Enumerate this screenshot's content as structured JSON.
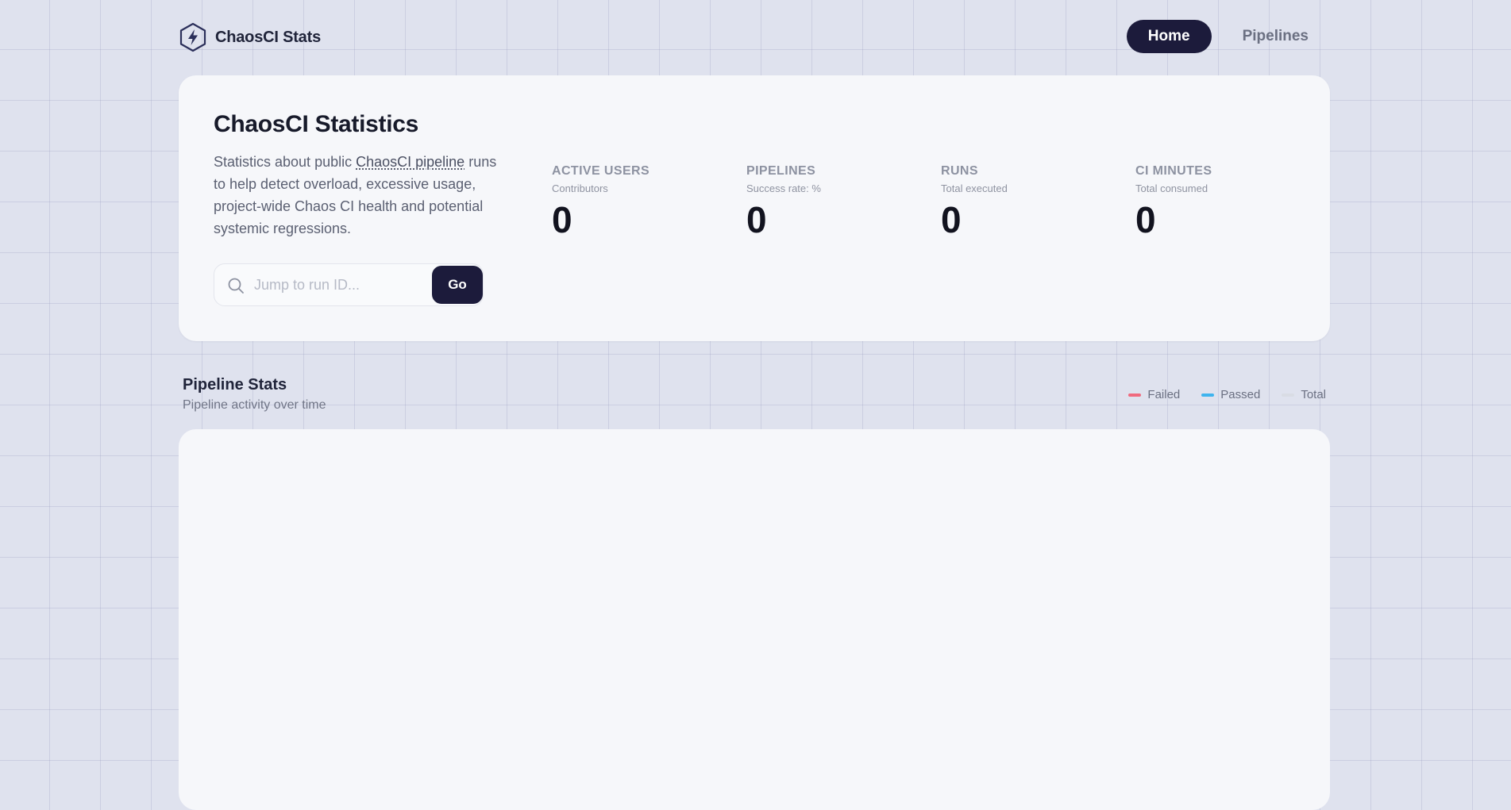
{
  "header": {
    "brand_name": "ChaosCI Stats",
    "brand_icon": "lightning-hexagon-icon",
    "nav": [
      {
        "label": "Home",
        "active": true
      },
      {
        "label": "Pipelines",
        "active": false
      }
    ]
  },
  "hero": {
    "title": "ChaosCI Statistics",
    "desc_before": "Statistics about public ",
    "desc_link": "ChaosCI pipeline",
    "desc_after": " runs to help detect overload, excessive usage, project-wide Chaos CI health and potential systemic regressions.",
    "search": {
      "placeholder": "Jump to run ID...",
      "value": "",
      "button_label": "Go"
    }
  },
  "stats": [
    {
      "label": "ACTIVE USERS",
      "sub": "Contributors",
      "value": "0"
    },
    {
      "label": "PIPELINES",
      "sub": "Success rate: %",
      "value": "0"
    },
    {
      "label": "RUNS",
      "sub": "Total executed",
      "value": "0"
    },
    {
      "label": "CI MINUTES",
      "sub": "Total consumed",
      "value": "0"
    }
  ],
  "pipeline_stats": {
    "title": "Pipeline Stats",
    "subtitle": "Pipeline activity over time",
    "legend": [
      {
        "label": "Failed",
        "color": "#f06a7e"
      },
      {
        "label": "Passed",
        "color": "#3fb4ee"
      },
      {
        "label": "Total",
        "color": "#d9dce4"
      }
    ]
  },
  "colors": {
    "accent": "#1c1b3b",
    "background": "#dfe2ee",
    "card": "#f6f7fa"
  }
}
